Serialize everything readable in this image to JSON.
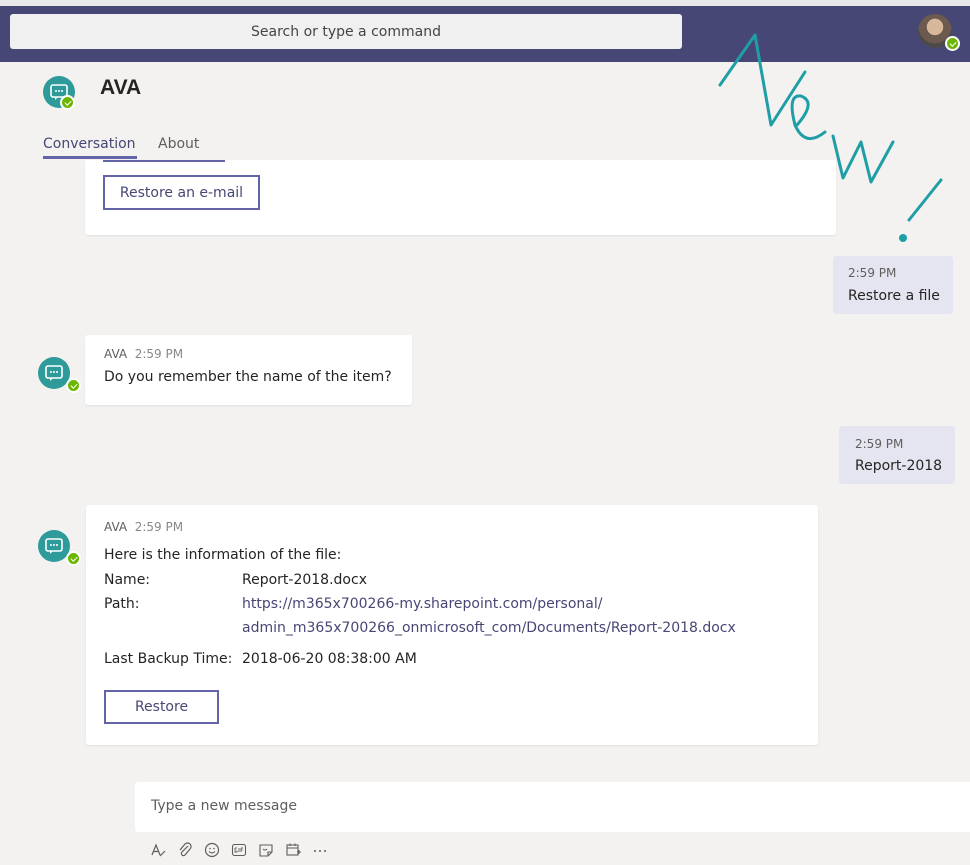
{
  "search": {
    "placeholder": "Search or type a command"
  },
  "chat": {
    "title": "AVA"
  },
  "tabs": [
    {
      "label": "Conversation",
      "active": true
    },
    {
      "label": "About",
      "active": false
    }
  ],
  "messages": {
    "restore_email_button": "Restore an e-mail",
    "sent1": {
      "time": "2:59 PM",
      "text": "Restore a file"
    },
    "bot1": {
      "sender": "AVA",
      "time": "2:59 PM",
      "text": "Do you remember the name of the item?"
    },
    "sent2": {
      "time": "2:59 PM",
      "text": "Report-2018"
    },
    "bot2": {
      "sender": "AVA",
      "time": "2:59 PM",
      "intro": "Here is the information of the file:",
      "name_label": "Name:",
      "name_value": "Report-2018.docx",
      "path_label": "Path:",
      "path_line1": "https://m365x700266-my.sharepoint.com/personal/",
      "path_line2": "admin_m365x700266_onmicrosoft_com/Documents/Report-2018.docx",
      "backup_label": "Last Backup Time:",
      "backup_value": "2018-06-20 08:38:00 AM",
      "restore_button": "Restore"
    }
  },
  "compose": {
    "placeholder": "Type a new message"
  },
  "toolbar_icons": [
    "format-icon",
    "attach-icon",
    "emoji-icon",
    "gif-icon",
    "sticker-icon",
    "meeting-icon",
    "more-options-icon"
  ],
  "overlay": {
    "text": "New!",
    "color": "#1f9ea6"
  },
  "colors": {
    "brand": "#464775",
    "accent": "#6264a7",
    "bot": "#2f9a9a",
    "presence": "#6bb700"
  }
}
